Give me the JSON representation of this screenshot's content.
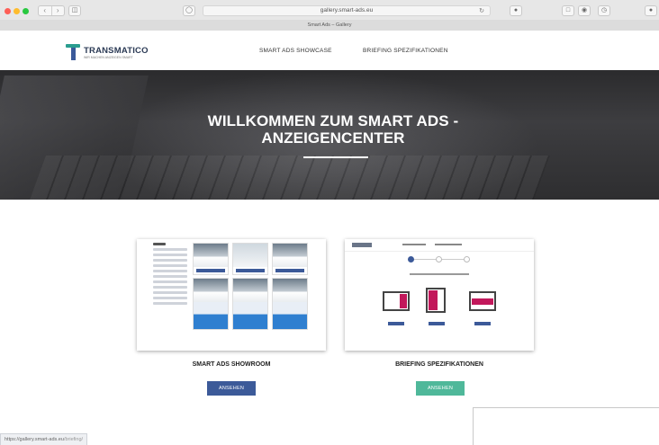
{
  "browser": {
    "address": "gallery.smart-ads.eu",
    "tab_title": "Smart Ads – Gallery",
    "status_url_base": "https://gallery.smart-ads.eu",
    "status_url_path": "/briefing/"
  },
  "site": {
    "logo_name": "TRANSMATICO",
    "logo_tagline": "WIR MACHEN ANZEIGEN SMART",
    "nav": [
      "SMART ADS SHOWCASE",
      "BRIEFING SPEZIFIKATIONEN"
    ],
    "hero_title": "WILLKOMMEN ZUM SMART ADS - ANZEIGENCENTER"
  },
  "cards": [
    {
      "title": "SMART ADS SHOWROOM",
      "button": "ANSEHEN",
      "button_color": "#3c5a99"
    },
    {
      "title": "BRIEFING SPEZIFIKATIONEN",
      "button": "ANSEHEN",
      "button_color": "#4fb89a"
    }
  ],
  "colors": {
    "accent_teal": "#2a9d8f",
    "brand_blue": "#3c5a99",
    "format_pink": "#c2185b"
  }
}
